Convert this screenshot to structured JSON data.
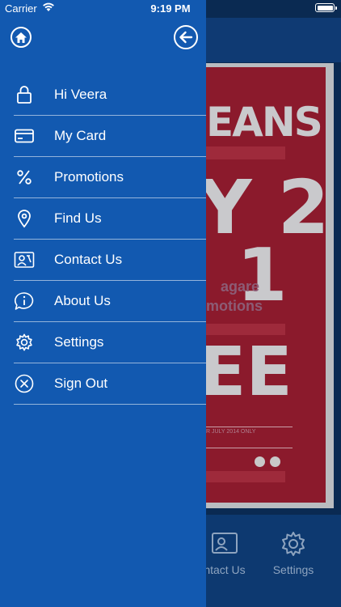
{
  "status_bar": {
    "carrier": "Carrier",
    "time": "9:19 PM"
  },
  "drawer": {
    "background_color": "#1259b0",
    "home_icon": "home-icon",
    "back_icon": "arrow-left-circle-icon",
    "items": [
      {
        "label": "Hi Veera",
        "icon": "lock-icon"
      },
      {
        "label": "My Card",
        "icon": "card-icon"
      },
      {
        "label": "Promotions",
        "icon": "percent-icon"
      },
      {
        "label": "Find Us",
        "icon": "location-pin-icon"
      },
      {
        "label": "Contact Us",
        "icon": "contact-card-icon"
      },
      {
        "label": "About Us",
        "icon": "info-bubble-icon"
      },
      {
        "label": "Settings",
        "icon": "gear-icon"
      },
      {
        "label": "Sign Out",
        "icon": "close-circle-icon"
      }
    ]
  },
  "background_app": {
    "poster": {
      "headline": "EANS",
      "big_line_1": "Y 2",
      "big_line_2": "1",
      "big_line_3": "EE",
      "blur_text_1": "agare",
      "blur_text_2": "motions",
      "small_text": "R JULY 2014 ONLY"
    },
    "tabs": [
      {
        "label": "ntact Us",
        "icon": "contact-card-icon"
      },
      {
        "label": "Settings",
        "icon": "gear-icon"
      }
    ]
  }
}
